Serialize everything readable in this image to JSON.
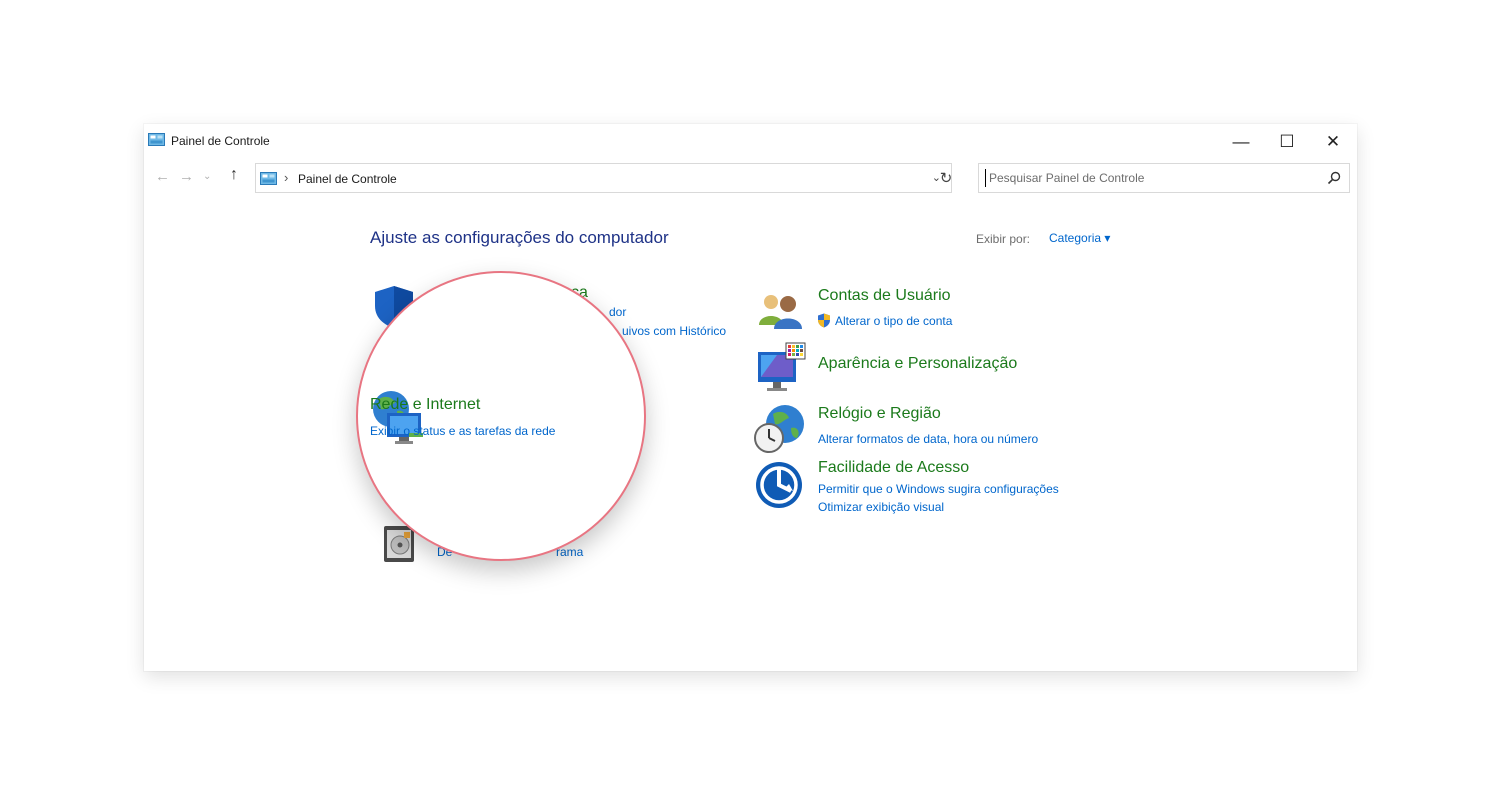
{
  "window": {
    "title": "Painel de Controle",
    "controls": {
      "minimize": "—",
      "maximize": "☐",
      "close": "✕"
    }
  },
  "nav": {
    "back": "←",
    "forward": "→",
    "history": "⌄",
    "up": "↑"
  },
  "address": {
    "separator": "›",
    "path": "Painel de Controle",
    "dropdown": "⌄",
    "refresh": "↻"
  },
  "search": {
    "placeholder": "Pesquisar Painel de Controle"
  },
  "content": {
    "heading": "Ajuste as configurações do computador",
    "view_by_label": "Exibir por:",
    "view_by_value": "Categoria ▾"
  },
  "left_categories": {
    "system_security": {
      "title_fragment": "ca",
      "link1_fragment": "dor",
      "link2_fragment": "uivos com Histórico"
    },
    "programs": {
      "link_fragment": "De",
      "link_fragment2": "rama"
    }
  },
  "magnifier": {
    "title": "Rede e Internet",
    "link": "Exibir o status e as tarefas da rede"
  },
  "right_categories": [
    {
      "title": "Contas de Usuário",
      "links": [
        "Alterar o tipo de conta"
      ]
    },
    {
      "title": "Aparência e Personalização",
      "links": []
    },
    {
      "title": "Relógio e Região",
      "links": [
        "Alterar formatos de data, hora ou número"
      ]
    },
    {
      "title": "Facilidade de Acesso",
      "links": [
        "Permitir que o Windows sugira configurações",
        "Otimizar exibição visual"
      ]
    }
  ],
  "colors": {
    "title_green": "#1b7a1b",
    "link_blue": "#0066cc",
    "heading_blue": "#1e3287",
    "magnifier_border": "#e87582"
  }
}
